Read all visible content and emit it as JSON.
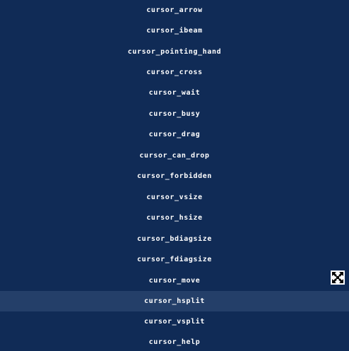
{
  "cursor_list": {
    "items": [
      {
        "label": "CURSOR_ARROW"
      },
      {
        "label": "CURSOR_IBEAM"
      },
      {
        "label": "CURSOR_POINTING_HAND"
      },
      {
        "label": "CURSOR_CROSS"
      },
      {
        "label": "CURSOR_WAIT"
      },
      {
        "label": "CURSOR_BUSY"
      },
      {
        "label": "CURSOR_DRAG"
      },
      {
        "label": "CURSOR_CAN_DROP"
      },
      {
        "label": "CURSOR_FORBIDDEN"
      },
      {
        "label": "CURSOR_VSIZE"
      },
      {
        "label": "CURSOR_HSIZE"
      },
      {
        "label": "CURSOR_BDIAGSIZE"
      },
      {
        "label": "CURSOR_FDIAGSIZE"
      },
      {
        "label": "CURSOR_MOVE"
      },
      {
        "label": "CURSOR_HSPLIT"
      },
      {
        "label": "CURSOR_VSPLIT"
      },
      {
        "label": "CURSOR_HELP"
      }
    ],
    "hovered_item": "CURSOR_HSPLIT"
  },
  "mouse_cursor": {
    "icon": "move-cursor-icon"
  },
  "colors": {
    "background": "#102b56",
    "hover_row": "#243f69",
    "text": "#ffffff"
  }
}
